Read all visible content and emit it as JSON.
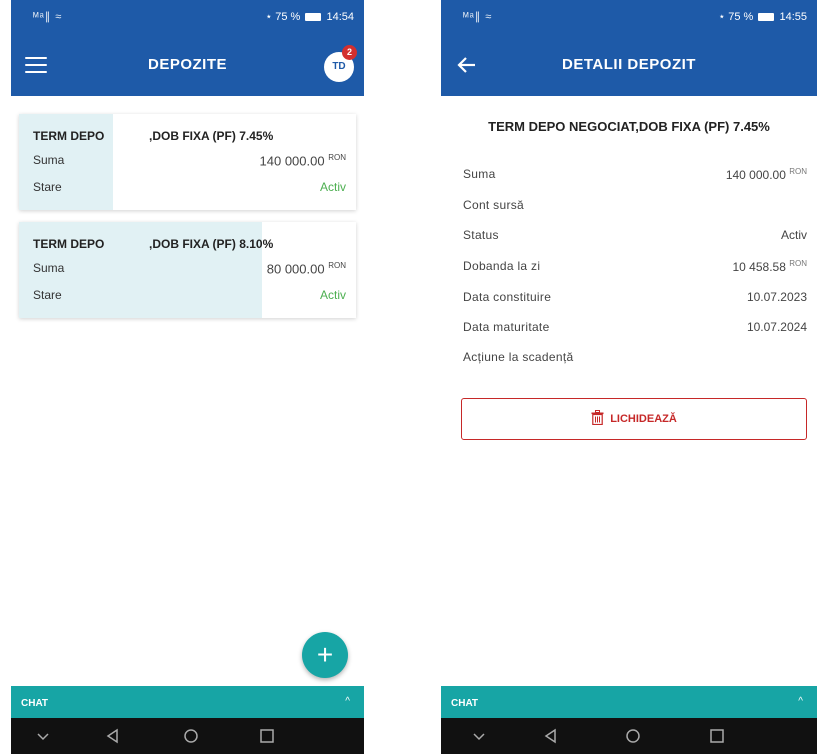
{
  "left": {
    "status": {
      "signal": "ᴹᵃ∥ ≈",
      "system": "⋆ 75 % ",
      "time": "14:54"
    },
    "title": "DEPOZITE",
    "avatar": {
      "initials": "TD",
      "badge": "2"
    },
    "deposits": [
      {
        "name": "TERM DEPO",
        "rate": ",DOB FIXA (PF) 7.45%",
        "amount_label": "Suma",
        "amount": "140 000.00",
        "currency": "RON",
        "state_label": "Stare",
        "state": "Activ",
        "fill": 0.28
      },
      {
        "name": "TERM DEPO",
        "rate": ",DOB FIXA (PF) 8.10%",
        "amount_label": "Suma",
        "amount": "80 000.00",
        "currency": "RON",
        "state_label": "Stare",
        "state": "Activ",
        "fill": 0.72
      }
    ],
    "fab": "+",
    "chat": {
      "label": "CHAT",
      "caret": "^"
    }
  },
  "right": {
    "status": {
      "signal": "ᴹᵃ∥ ≈",
      "system": "⋆ 75 % ",
      "time": "14:55"
    },
    "title": "DETALII DEPOZIT",
    "deposit_title": "TERM DEPO NEGOCIAT,DOB FIXA (PF) 7.45%",
    "details": [
      {
        "label": "Suma",
        "value": "140 000.00",
        "currency": "RON"
      },
      {
        "label": "Cont sursă",
        "value": "",
        "currency": ""
      },
      {
        "label": "Status",
        "value": "Activ",
        "currency": ""
      },
      {
        "label": "Dobanda la zi",
        "value": "10 458.58",
        "currency": "RON"
      },
      {
        "label": "Data constituire",
        "value": "10.07.2023",
        "currency": ""
      },
      {
        "label": "Data maturitate",
        "value": "10.07.2024",
        "currency": ""
      },
      {
        "label": "Acțiune la scadență",
        "value": "",
        "currency": ""
      }
    ],
    "liquidate_label": "LICHIDEAZĂ",
    "chat": {
      "label": "CHAT",
      "caret": "^"
    }
  },
  "colors": {
    "brand": "#1e5aa8",
    "accent": "#17a5a5",
    "active": "#4caf50",
    "danger": "#c62828",
    "card_fill": "#e1f1f4"
  },
  "icons": [
    "menu-icon",
    "back-icon",
    "plus-icon",
    "trash-icon",
    "nav-back-icon",
    "nav-home-icon",
    "nav-recents-icon",
    "nav-collapse-icon"
  ]
}
